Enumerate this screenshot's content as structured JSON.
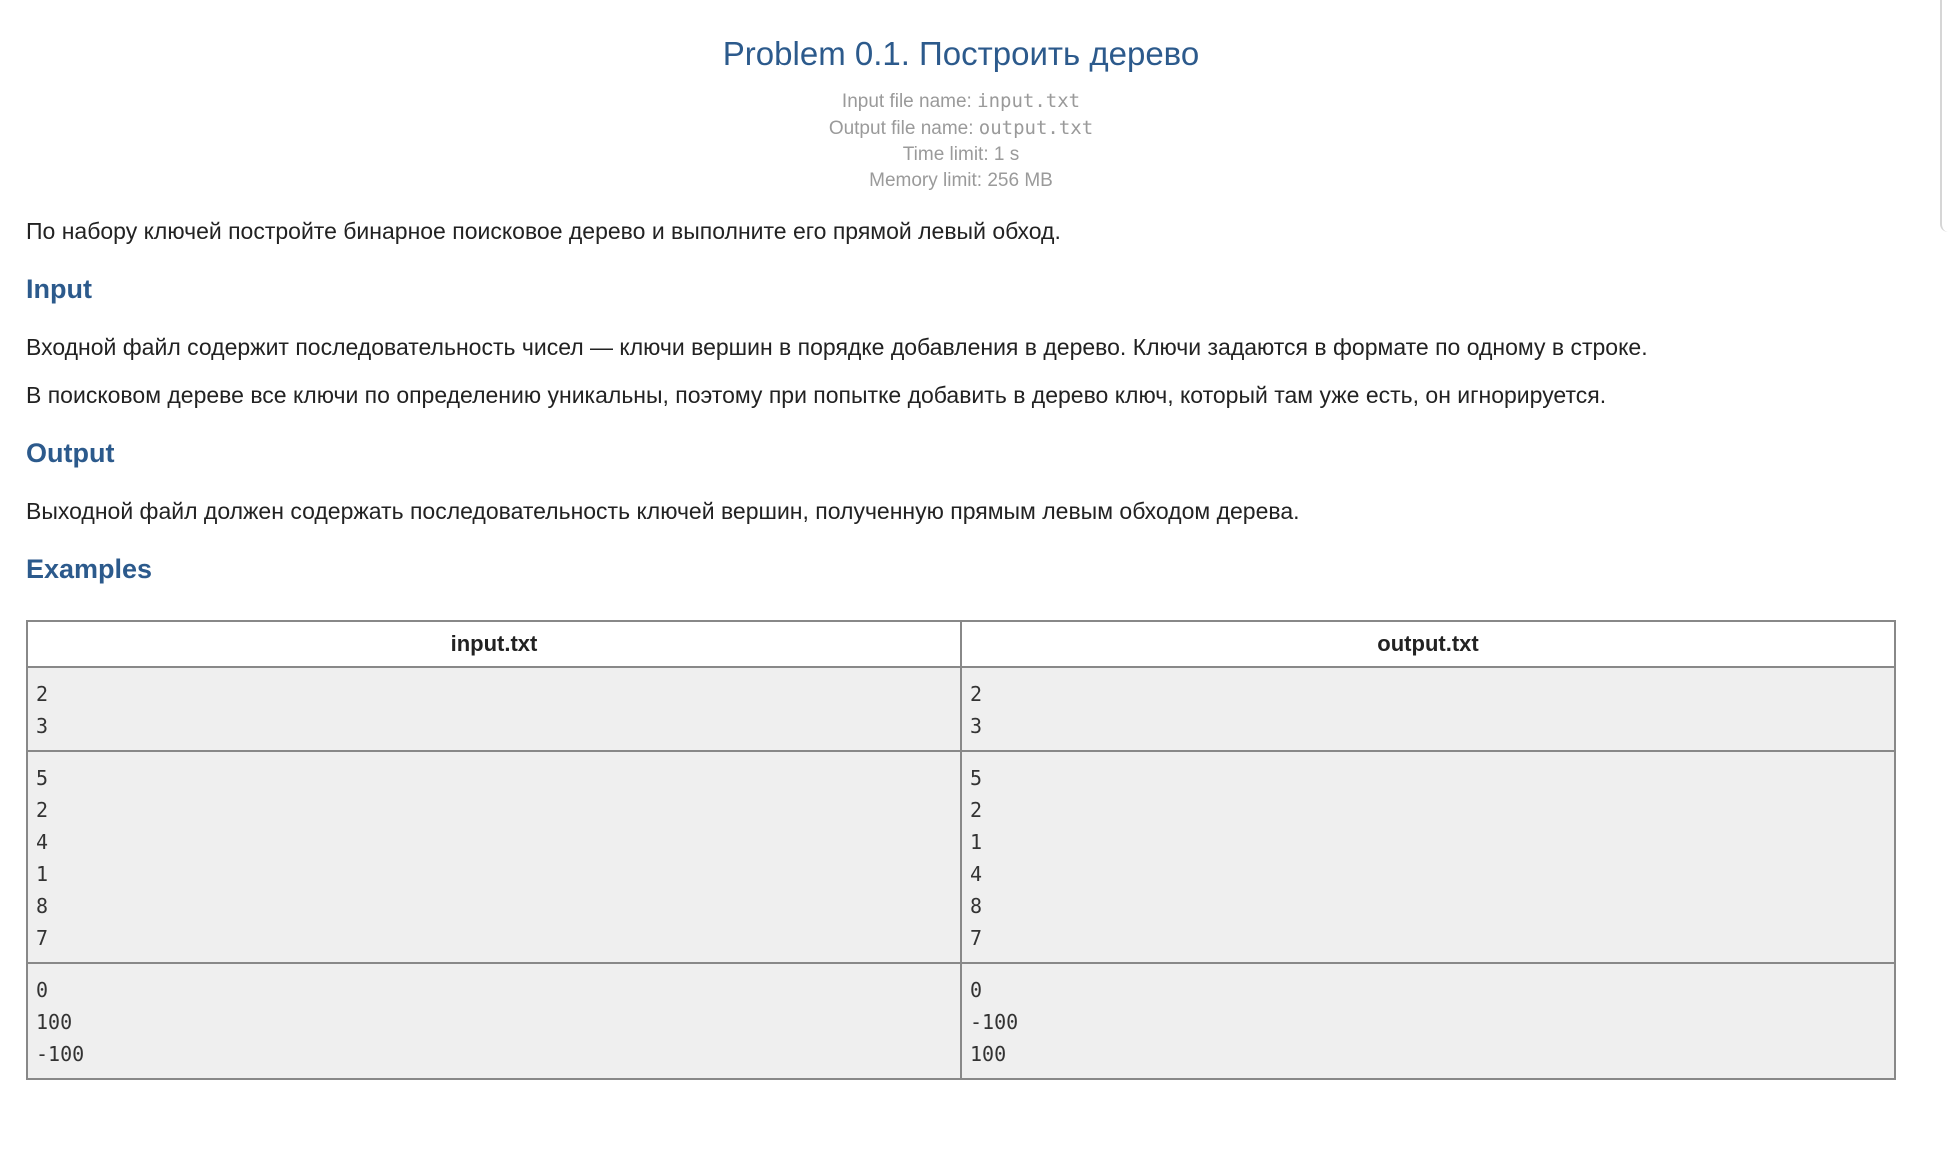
{
  "problem": {
    "title": "Problem 0.1. Построить дерево",
    "limits": {
      "input_label": "Input file name: ",
      "input_file": "input.txt",
      "output_label": "Output file name: ",
      "output_file": "output.txt",
      "time_limit": "Time limit: 1 s",
      "memory_limit": "Memory limit: 256 MB"
    },
    "statement": "По набору ключей постройте бинарное поисковое дерево и выполните его прямой левый обход.",
    "input_heading": "Input",
    "input_paragraphs": [
      "Входной файл содержит последовательность чисел — ключи вершин в порядке добавления в дерево. Ключи задаются в формате по одному в строке.",
      "В поисковом дереве все ключи по определению уникальны, поэтому при попытке добавить в дерево ключ, который там уже есть, он игнорируется."
    ],
    "output_heading": "Output",
    "output_paragraph": "Выходной файл должен содержать последовательность ключей вершин, полученную прямым левым обходом дерева.",
    "examples_heading": "Examples"
  },
  "examples": {
    "headers": [
      "input.txt",
      "output.txt"
    ],
    "rows": [
      {
        "input": [
          "2",
          "3"
        ],
        "output": [
          "2",
          "3"
        ]
      },
      {
        "input": [
          "5",
          "2",
          "4",
          "1",
          "8",
          "7"
        ],
        "output": [
          "5",
          "2",
          "1",
          "4",
          "8",
          "7"
        ]
      },
      {
        "input": [
          "0",
          "100",
          "-100"
        ],
        "output": [
          "0",
          "-100",
          "100"
        ]
      }
    ]
  }
}
